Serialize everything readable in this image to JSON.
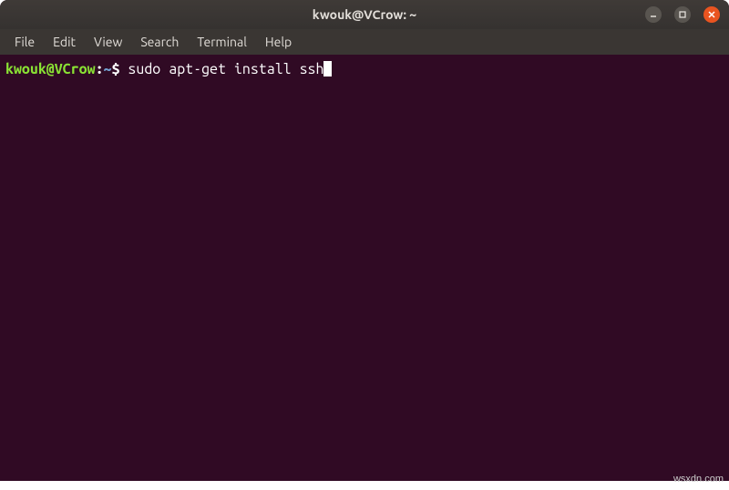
{
  "window": {
    "title": "kwouk@VCrow: ~"
  },
  "menu": {
    "items": [
      "File",
      "Edit",
      "View",
      "Search",
      "Terminal",
      "Help"
    ]
  },
  "terminal": {
    "prompt": {
      "user_host": "kwouk@VCrow",
      "separator": ":",
      "path": "~",
      "symbol": "$"
    },
    "command": " sudo apt-get install ssh"
  },
  "icons": {
    "minimize": "minimize-icon",
    "maximize": "maximize-icon",
    "close": "close-icon"
  },
  "watermark": "wsxdn.com"
}
